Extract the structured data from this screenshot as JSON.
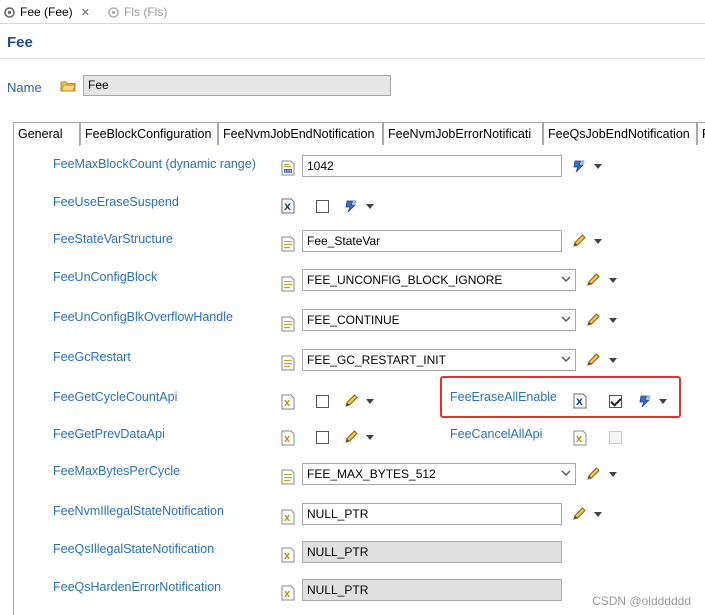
{
  "editor_tabs": [
    {
      "label": "Fee (Fee)",
      "active": true
    },
    {
      "label": "Fls (Fls)",
      "active": false
    }
  ],
  "page_title": "Fee",
  "name_label": "Name",
  "name_value": "Fee",
  "config_tabs": [
    "General",
    "FeeBlockConfiguration",
    "FeeNvmJobEndNotification",
    "FeeNvmJobErrorNotificati",
    "FeeQsJobEndNotification",
    "F"
  ],
  "rows": {
    "max_block_count": {
      "label": "FeeMaxBlockCount (dynamic range)",
      "value": "1042"
    },
    "use_erase_suspend": {
      "label": "FeeUseEraseSuspend",
      "checked": false
    },
    "state_var_structure": {
      "label": "FeeStateVarStructure",
      "value": "Fee_StateVar"
    },
    "unconfig_block": {
      "label": "FeeUnConfigBlock",
      "value": "FEE_UNCONFIG_BLOCK_IGNORE"
    },
    "unconfig_blk_overflow": {
      "label": "FeeUnConfigBlkOverflowHandle",
      "value": "FEE_CONTINUE"
    },
    "gc_restart": {
      "label": "FeeGcRestart",
      "value": "FEE_GC_RESTART_INIT"
    },
    "get_cycle_count_api": {
      "label": "FeeGetCycleCountApi",
      "checked": false
    },
    "erase_all_enable": {
      "label": "FeeEraseAllEnable",
      "checked": true
    },
    "get_prev_data_api": {
      "label": "FeeGetPrevDataApi",
      "checked": false
    },
    "cancel_all_api": {
      "label": "FeeCancelAllApi",
      "checked": false
    },
    "max_bytes_per_cycle": {
      "label": "FeeMaxBytesPerCycle",
      "value": "FEE_MAX_BYTES_512"
    },
    "nvm_illegal_state": {
      "label": "FeeNvmIllegalStateNotification",
      "value": "NULL_PTR"
    },
    "qs_illegal_state": {
      "label": "FeeQsIllegalStateNotification",
      "value": "NULL_PTR"
    },
    "qs_harden_error": {
      "label": "FeeQsHardenErrorNotification",
      "value": "NULL_PTR"
    }
  },
  "watermark": "CSDN @oldddddd",
  "colors": {
    "link_label": "#2a6fc0",
    "title": "#1f4e8c",
    "highlight": "#e8302a"
  }
}
